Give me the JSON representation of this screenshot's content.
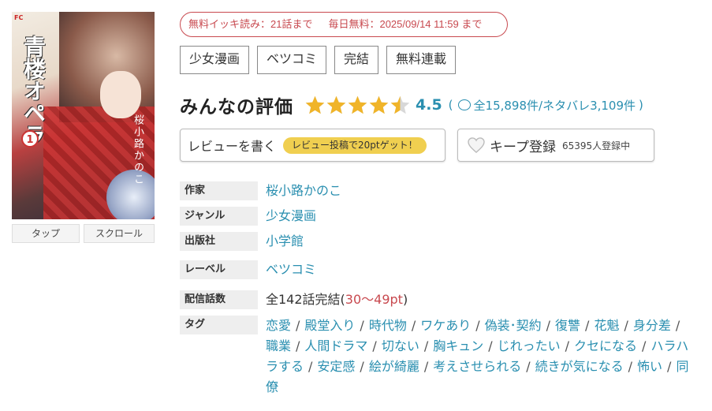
{
  "cover": {
    "publisher_mark": "FC",
    "title": "青楼オペラ",
    "volume": "1",
    "author": "桜小路かのこ"
  },
  "cover_buttons": {
    "tap": "タップ",
    "scroll": "スクロール"
  },
  "free_info": {
    "bulk": "無料イッキ読み：21話まで",
    "daily": "毎日無料：2025/09/14 11:59 まで"
  },
  "top_tags": [
    "少女漫画",
    "ベツコミ",
    "完結",
    "無料連載"
  ],
  "rating": {
    "title": "みんなの評価",
    "value": "4.5",
    "stars_filled": 4.5,
    "count_text": "全15,898件/ネタバレ3,109件",
    "paren_open": "(",
    "paren_close": ")",
    "star_color": "#f0b429"
  },
  "review_button": {
    "label": "レビューを書く",
    "bonus": "レビュー投稿で20ptゲット！"
  },
  "keep_button": {
    "label": "キープ登録",
    "count": "65395人登録中"
  },
  "info": {
    "author_label": "作家",
    "author": "桜小路かのこ",
    "genre_label": "ジャンル",
    "genre": "少女漫画",
    "publisher_label": "出版社",
    "publisher": "小学館",
    "label_label": "レーベル",
    "label": "ベツコミ",
    "episodes_label": "配信話数",
    "episodes": "全142話完結(",
    "episodes_pt": "30〜49pt",
    "episodes_close": ")",
    "tags_label": "タグ",
    "tags": [
      "恋愛",
      "殿堂入り",
      "時代物",
      "ワケあり",
      "偽装･契約",
      "復讐",
      "花魁",
      "身分差",
      "職業",
      "人間ドラマ",
      "切ない",
      "胸キュン",
      "じれったい",
      "クセになる",
      "ハラハラする",
      "安定感",
      "絵が綺麗",
      "考えさせられる",
      "続きが気になる",
      "怖い",
      "同僚"
    ]
  },
  "colors": {
    "accent_red": "#c8494f",
    "link_blue": "#2a8fb0",
    "bonus_yellow": "#f0cf50"
  }
}
